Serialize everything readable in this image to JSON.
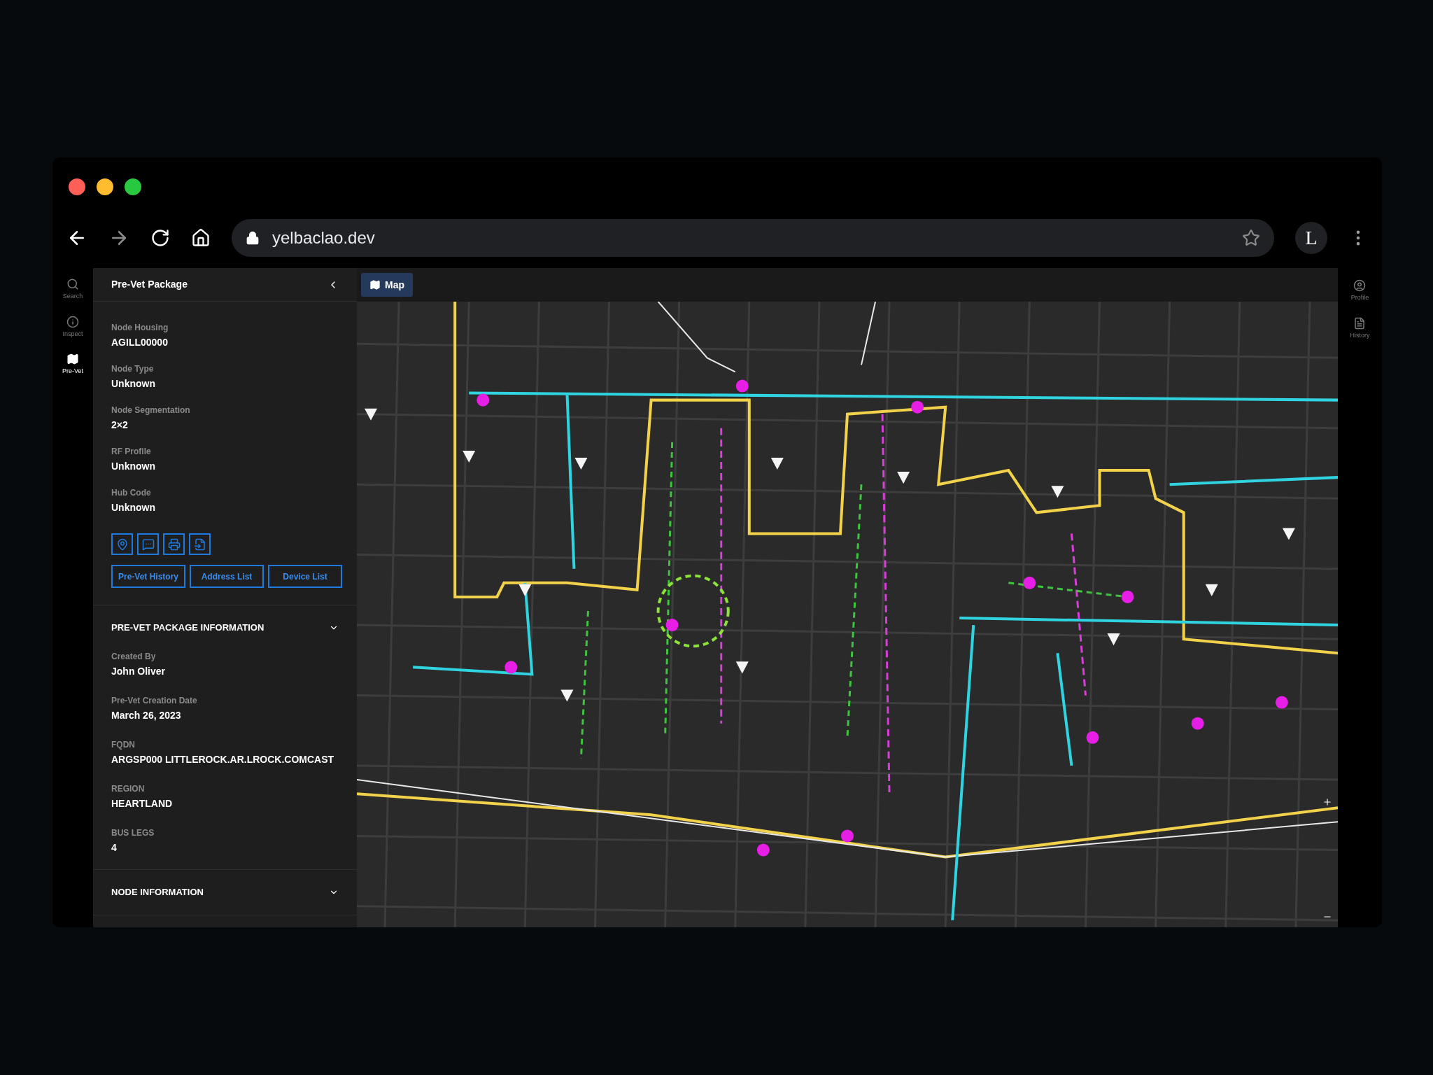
{
  "browser": {
    "url": "yelbaclao.dev",
    "profile_initial": "L"
  },
  "left_rail": [
    {
      "label": "Search",
      "selected": false
    },
    {
      "label": "Inspect",
      "selected": false
    },
    {
      "label": "Pre-Vet",
      "selected": true
    }
  ],
  "panel": {
    "title": "Pre-Vet Package",
    "fields": [
      {
        "label": "Node Housing",
        "value": "AGILL00000"
      },
      {
        "label": "Node Type",
        "value": "Unknown"
      },
      {
        "label": "Node Segmentation",
        "value": "2×2"
      },
      {
        "label": "RF Profile",
        "value": "Unknown"
      },
      {
        "label": "Hub Code",
        "value": "Unknown"
      }
    ],
    "buttons": [
      "Pre-Vet History",
      "Address List",
      "Device List"
    ],
    "sections": [
      {
        "title": "PRE-VET PACKAGE INFORMATION",
        "expanded": true,
        "fields": [
          {
            "label": "Created By",
            "value": "John Oliver"
          },
          {
            "label": "Pre-Vet Creation Date",
            "value": "March 26, 2023"
          },
          {
            "label": "FQDN",
            "value": "ARGSP000 LITTLEROCK.AR.LROCK.COMCAST"
          },
          {
            "label": "REGION",
            "value": "HEARTLAND"
          },
          {
            "label": "BUS LEGS",
            "value": "4"
          }
        ]
      },
      {
        "title": "NODE INFORMATION",
        "expanded": false
      }
    ]
  },
  "map_tabs": [
    {
      "label": "Map",
      "selected": true
    }
  ],
  "right_rail": [
    {
      "label": "Profile"
    },
    {
      "label": "History"
    }
  ]
}
